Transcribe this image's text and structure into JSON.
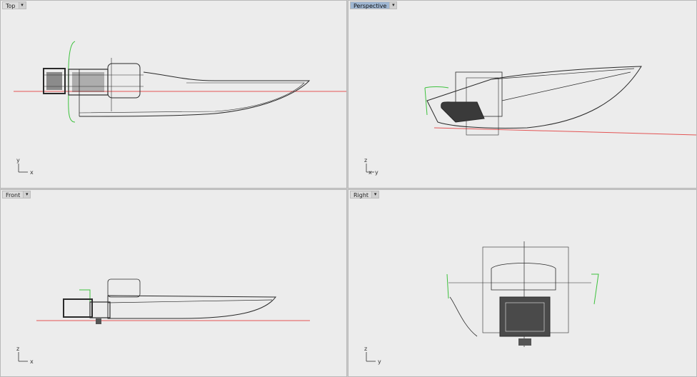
{
  "viewports": {
    "top": {
      "title": "Top",
      "active": false,
      "axis_h": "x",
      "axis_v": "y"
    },
    "perspective": {
      "title": "Perspective",
      "active": true,
      "axis_h": "y",
      "axis_v": "z",
      "axis_extra": "x"
    },
    "front": {
      "title": "Front",
      "active": false,
      "axis_h": "x",
      "axis_v": "z"
    },
    "right": {
      "title": "Right",
      "active": false,
      "axis_h": "y",
      "axis_v": "z"
    }
  },
  "icons": {
    "dropdown": "chevron-down-icon"
  },
  "colors": {
    "x_axis_line": "#e35454",
    "construction_curve": "#3ec23e",
    "wireframe": "#2a2a2a",
    "viewport_bg": "#ececec",
    "active_tab": "#9fb6d2"
  }
}
